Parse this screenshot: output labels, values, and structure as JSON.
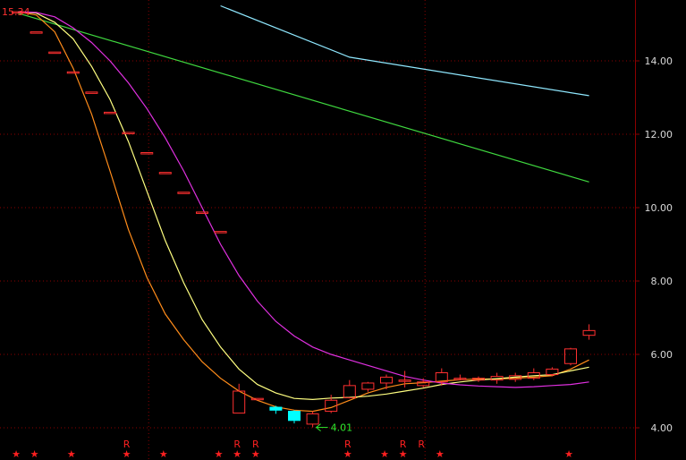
{
  "chart_data": {
    "type": "candlestick",
    "title": "",
    "xlabel": "",
    "ylabel": "",
    "ylim": [
      3.8,
      15.6
    ],
    "y_ticks": [
      4,
      6,
      8,
      10,
      12,
      14
    ],
    "y_tick_labels": [
      "4.00",
      "6.00",
      "8.00",
      "10.00",
      "12.00",
      "14.00"
    ],
    "grid": true,
    "n_bars": 32,
    "colors": {
      "background": "#000000",
      "grid": "#8b0000",
      "axis": "#8b0000",
      "tick_text": "#d8d8d8",
      "up": "#ff3030",
      "down": "#00ffff",
      "marker": "#ff2020",
      "low_label": "#2ee82e",
      "high_label": "#ff3030"
    },
    "candles": [
      {
        "o": 15.34,
        "h": 15.34,
        "c": 15.34,
        "l": 15.34
      },
      {
        "o": 14.79,
        "h": 14.79,
        "c": 14.79,
        "l": 14.79
      },
      {
        "o": 14.24,
        "h": 14.24,
        "c": 14.24,
        "l": 14.24
      },
      {
        "o": 13.7,
        "h": 13.7,
        "c": 13.7,
        "l": 13.7
      },
      {
        "o": 13.15,
        "h": 13.15,
        "c": 13.15,
        "l": 13.15
      },
      {
        "o": 12.6,
        "h": 12.6,
        "c": 12.6,
        "l": 12.6
      },
      {
        "o": 12.05,
        "h": 12.05,
        "c": 12.05,
        "l": 12.05
      },
      {
        "o": 11.5,
        "h": 11.5,
        "c": 11.5,
        "l": 11.5
      },
      {
        "o": 10.96,
        "h": 10.96,
        "c": 10.96,
        "l": 10.96
      },
      {
        "o": 10.42,
        "h": 10.42,
        "c": 10.42,
        "l": 10.42
      },
      {
        "o": 9.88,
        "h": 9.88,
        "c": 9.88,
        "l": 9.88
      },
      {
        "o": 9.35,
        "h": 9.35,
        "c": 9.35,
        "l": 9.35
      },
      {
        "o": 4.4,
        "h": 5.2,
        "c": 5.0,
        "l": 4.4
      },
      {
        "o": 4.8,
        "h": 4.8,
        "c": 4.8,
        "l": 4.8
      },
      {
        "o": 4.56,
        "h": 4.6,
        "c": 4.48,
        "l": 4.38
      },
      {
        "o": 4.45,
        "h": 4.48,
        "c": 4.2,
        "l": 4.12
      },
      {
        "o": 4.1,
        "h": 4.45,
        "c": 4.38,
        "l": 4.01
      },
      {
        "o": 4.45,
        "h": 4.9,
        "c": 4.75,
        "l": 4.4
      },
      {
        "o": 4.82,
        "h": 5.3,
        "c": 5.15,
        "l": 4.8
      },
      {
        "o": 5.05,
        "h": 5.25,
        "c": 5.22,
        "l": 4.98
      },
      {
        "o": 5.22,
        "h": 5.45,
        "c": 5.38,
        "l": 5.05
      },
      {
        "o": 5.28,
        "h": 5.55,
        "c": 5.3,
        "l": 5.1
      },
      {
        "o": 5.15,
        "h": 5.35,
        "c": 5.25,
        "l": 5.1
      },
      {
        "o": 5.25,
        "h": 5.62,
        "c": 5.5,
        "l": 5.15
      },
      {
        "o": 5.35,
        "h": 5.45,
        "c": 5.35,
        "l": 5.3
      },
      {
        "o": 5.3,
        "h": 5.4,
        "c": 5.35,
        "l": 5.25
      },
      {
        "o": 5.3,
        "h": 5.5,
        "c": 5.4,
        "l": 5.2
      },
      {
        "o": 5.32,
        "h": 5.5,
        "c": 5.42,
        "l": 5.25
      },
      {
        "o": 5.35,
        "h": 5.62,
        "c": 5.5,
        "l": 5.3
      },
      {
        "o": 5.45,
        "h": 5.65,
        "c": 5.6,
        "l": 5.4
      },
      {
        "o": 5.75,
        "h": 6.18,
        "c": 6.15,
        "l": 5.7
      },
      {
        "o": 6.52,
        "h": 6.82,
        "c": 6.65,
        "l": 6.4
      }
    ],
    "series": [
      {
        "color": "#ff8c1a",
        "values": [
          15.34,
          15.25,
          14.79,
          13.8,
          12.55,
          11.0,
          9.4,
          8.1,
          7.1,
          6.4,
          5.8,
          5.35,
          5.0,
          4.75,
          4.57,
          4.48,
          4.45,
          4.55,
          4.75,
          4.95,
          5.1,
          5.2,
          5.23,
          5.27,
          5.31,
          5.33,
          5.33,
          5.35,
          5.38,
          5.42,
          5.6,
          5.85
        ]
      },
      {
        "color": "#ffff80",
        "values": [
          15.34,
          15.3,
          15.05,
          14.6,
          13.85,
          12.95,
          11.8,
          10.45,
          9.1,
          7.95,
          6.95,
          6.2,
          5.6,
          5.18,
          4.95,
          4.8,
          4.77,
          4.81,
          4.83,
          4.86,
          4.92,
          5.0,
          5.08,
          5.18,
          5.25,
          5.3,
          5.34,
          5.38,
          5.42,
          5.45,
          5.55,
          5.65
        ]
      },
      {
        "color": "#e030e0",
        "values": [
          15.34,
          15.32,
          15.2,
          14.9,
          14.5,
          14.0,
          13.4,
          12.7,
          11.9,
          11.0,
          10.0,
          9.0,
          8.15,
          7.45,
          6.9,
          6.5,
          6.2,
          6.0,
          5.85,
          5.7,
          5.55,
          5.4,
          5.3,
          5.22,
          5.17,
          5.14,
          5.12,
          5.1,
          5.12,
          5.15,
          5.18,
          5.25
        ]
      }
    ],
    "long_series": [
      {
        "color": "#3fd83f",
        "x": [
          0,
          31
        ],
        "values": [
          15.3,
          10.7
        ]
      },
      {
        "color": "#8fe8ff",
        "x": [
          11,
          18,
          31
        ],
        "values": [
          15.5,
          14.1,
          13.05
        ]
      }
    ],
    "vlines_at": [
      7,
      22
    ],
    "star_marks_at": [
      0,
      1,
      3,
      6,
      8,
      11,
      12,
      13,
      18,
      20,
      21,
      23,
      30
    ],
    "r_marks_at": [
      6,
      12,
      13,
      18,
      21,
      22
    ],
    "annotations": {
      "high_label": "15.34",
      "high_index": 0,
      "low_label": "4.01",
      "low_index": 16,
      "star_glyph": "★",
      "r_glyph": "R"
    }
  }
}
